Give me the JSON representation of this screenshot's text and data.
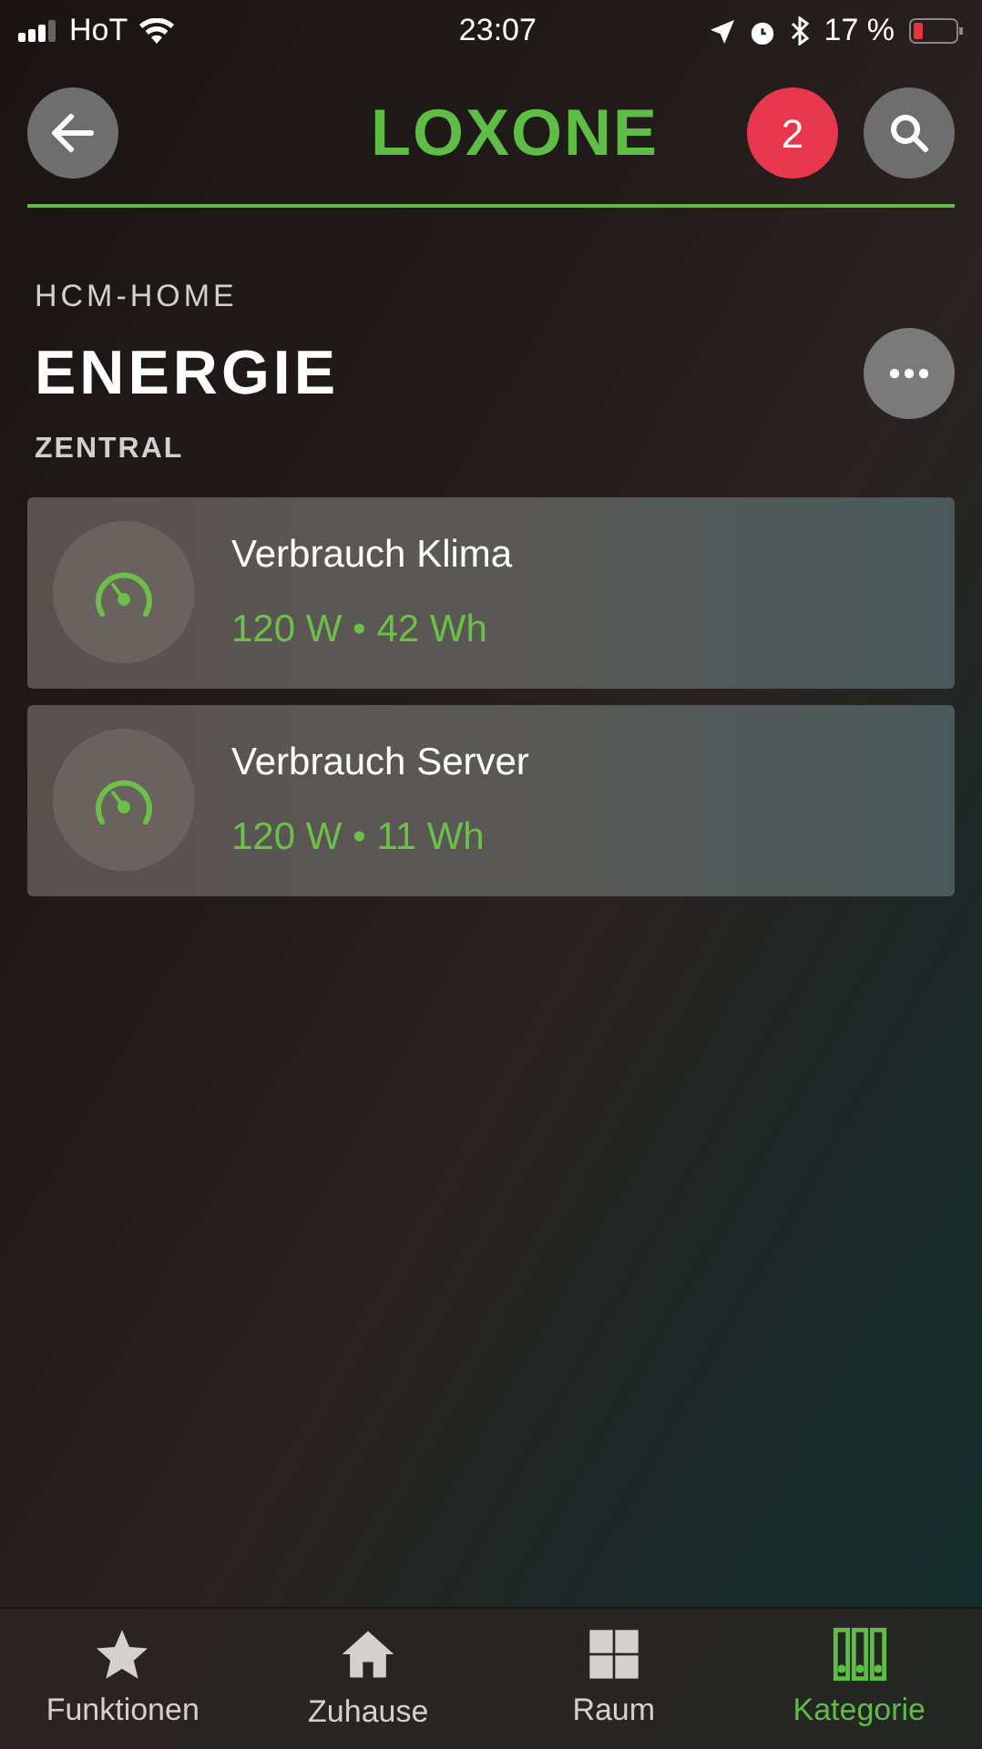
{
  "status_bar": {
    "carrier": "HoT",
    "time": "23:07",
    "battery": "17 %"
  },
  "header": {
    "logo": "LOXONE",
    "notifications": "2"
  },
  "location": "HCM-HOME",
  "title": "ENERGIE",
  "section": "ZENTRAL",
  "items": [
    {
      "name": "Verbrauch Klima",
      "value": "120 W • 42 Wh"
    },
    {
      "name": "Verbrauch Server",
      "value": "120 W • 11 Wh"
    }
  ],
  "tabs": [
    {
      "kind": "star",
      "label": "Funktionen",
      "selected": false
    },
    {
      "kind": "house",
      "label": "Zuhause",
      "selected": false
    },
    {
      "kind": "grid",
      "label": "Raum",
      "selected": false
    },
    {
      "kind": "binders",
      "label": "Kategorie",
      "selected": true
    }
  ]
}
